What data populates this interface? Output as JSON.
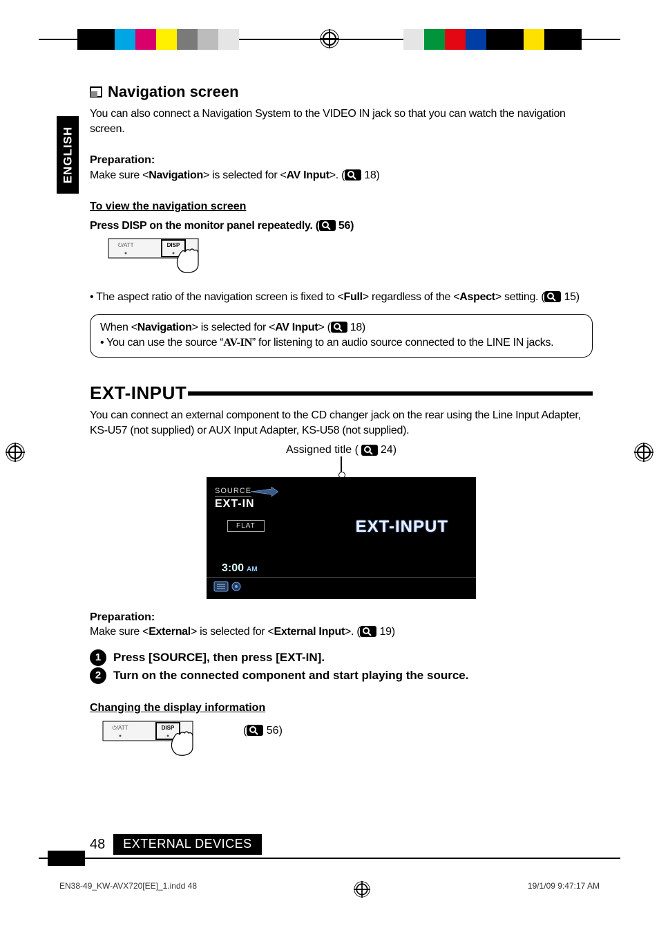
{
  "lang_tab": "ENGLISH",
  "nav": {
    "heading": "Navigation screen",
    "intro": "You can also connect a Navigation System to the VIDEO IN jack so that you can watch the navigation screen.",
    "prep_label": "Preparation:",
    "prep_pre": "Make sure <",
    "prep_bold1": "Navigation",
    "prep_mid": "> is selected for <",
    "prep_bold2": "AV Input",
    "prep_post": ">. (",
    "prep_ref": " 18)",
    "view_heading": "To view the navigation screen",
    "press_pre": "Press DISP on the monitor panel repeatedly. (",
    "press_ref": " 56)",
    "aspect_pre": "•  The aspect ratio of the navigation screen is fixed to <",
    "aspect_b1": "Full",
    "aspect_mid": "> regardless of the <",
    "aspect_b2": "Aspect",
    "aspect_post": "> setting. (",
    "aspect_ref": " 15)",
    "note_l1_pre": "When <",
    "note_l1_b1": "Navigation",
    "note_l1_mid": "> is selected for <",
    "note_l1_b2": "AV Input",
    "note_l1_post": "> (",
    "note_l1_ref": " 18)",
    "note_l2_pre": "•  You can use the source “",
    "note_l2_b": "AV-IN",
    "note_l2_post": "” for listening to an audio source connected to the LINE IN jacks."
  },
  "ext": {
    "heading": "EXT-INPUT",
    "intro": "You can connect an external component to the CD changer jack on the rear using the Line Input Adapter, KS-U57 (not supplied) or AUX Input Adapter, KS-U58 (not supplied).",
    "caption_pre": "Assigned title (",
    "caption_ref": " 24)",
    "shot": {
      "source_label": "SOURCE",
      "source_value": "EXT-IN",
      "eq_label": "FLAT",
      "main_text": "EXT-INPUT",
      "time": "3:00",
      "time_suffix": "AM"
    },
    "prep_label": "Preparation:",
    "prep_pre": "Make sure <",
    "prep_b1": "External",
    "prep_mid": "> is selected for <",
    "prep_b2": "External Input",
    "prep_post": ">. (",
    "prep_ref": " 19)",
    "step1_num": "1",
    "step1": "Press [SOURCE], then press [EXT-IN].",
    "step2_num": "2",
    "step2": " Turn on the connected component and start playing the source.",
    "change_heading": "Changing the display information",
    "disp_ref_pre": "(",
    "disp_ref": " 56)"
  },
  "panel": {
    "att": "/ATT",
    "disp": "DISP"
  },
  "footer": {
    "page": "48",
    "section": "EXTERNAL DEVICES",
    "file": "EN38-49_KW-AVX720[EE]_1.indd   48",
    "date": "19/1/09   9:47:17 AM"
  },
  "topbar": {
    "left_colors": [
      "#000000",
      "#00a5e3",
      "#d9006c",
      "#fff000",
      "#7a7a7a",
      "#bcbcbc",
      "#e5e5e5"
    ],
    "right_colors": [
      "#e5e5e5",
      "#00953b",
      "#e30613",
      "#003da5",
      "#000000",
      "#ffe100",
      "#000000"
    ]
  }
}
